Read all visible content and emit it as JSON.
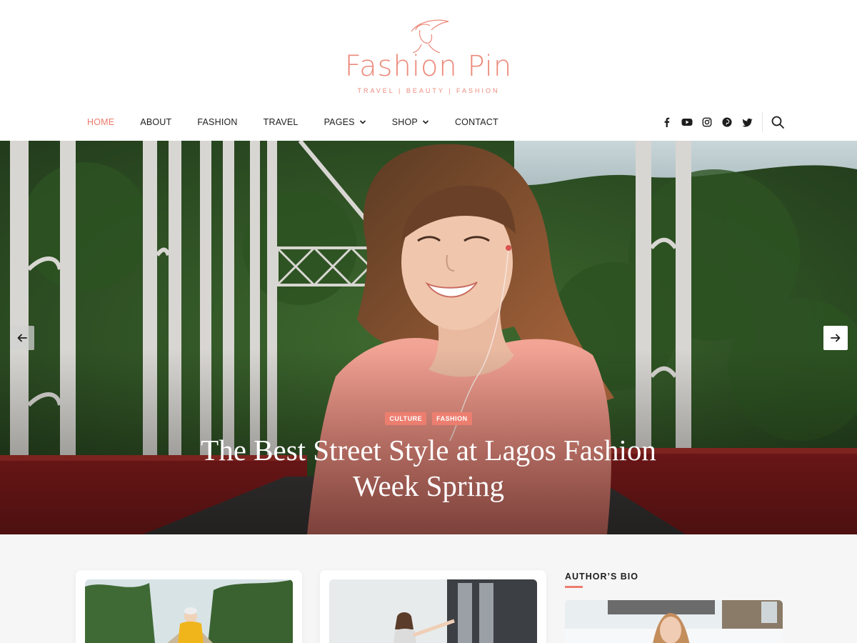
{
  "site": {
    "title": "Fashion Pin",
    "tagline": "TRAVEL | BEAUTY | FASHION"
  },
  "nav": {
    "items": [
      {
        "label": "HOME",
        "active": true,
        "has_dropdown": false
      },
      {
        "label": "ABOUT",
        "active": false,
        "has_dropdown": false
      },
      {
        "label": "FASHION",
        "active": false,
        "has_dropdown": false
      },
      {
        "label": "TRAVEL",
        "active": false,
        "has_dropdown": false
      },
      {
        "label": "PAGES",
        "active": false,
        "has_dropdown": true
      },
      {
        "label": "SHOP",
        "active": false,
        "has_dropdown": true
      },
      {
        "label": "CONTACT",
        "active": false,
        "has_dropdown": false
      }
    ],
    "social_icons": [
      "facebook-icon",
      "youtube-icon",
      "instagram-icon",
      "pinterest-icon",
      "twitter-icon"
    ],
    "search_icon": "search-icon"
  },
  "hero": {
    "categories": [
      "CULTURE",
      "FASHION"
    ],
    "title": "The Best Street Style at Lagos Fashion Week Spring",
    "prev_icon": "arrow-left-icon",
    "next_icon": "arrow-right-icon"
  },
  "sidebar": {
    "widget_title": "AUTHOR’S BIO"
  },
  "colors": {
    "accent": "#ec7e70",
    "logo": "#ec8a7b",
    "text": "#1e1e1e",
    "content_bg": "#f6f6f6"
  }
}
